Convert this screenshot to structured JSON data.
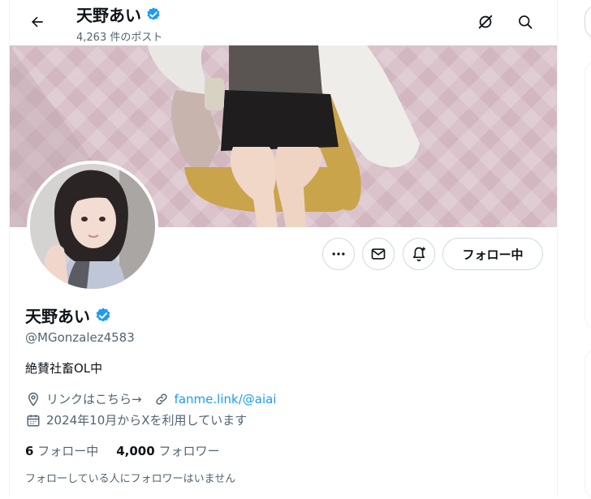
{
  "header": {
    "name": "天野あい",
    "post_count": "4,263 件のポスト",
    "verified": true,
    "back_icon": "arrow-left-icon",
    "right_icons": [
      "grok-icon",
      "search-icon"
    ]
  },
  "profile": {
    "name": "天野あい",
    "handle": "@MGonzalez4583",
    "bio": "絶賛社畜OL中",
    "link_label": "リンクはこちら→",
    "link_url": "fanme.link/@aiai",
    "joined": "2024年10月からXを利用しています",
    "following_count": "6",
    "following_label": "フォロー中",
    "followers_count": "4,000",
    "followers_label": "フォロワー",
    "mutual_note": "フォローしている人にフォロワーはいません"
  },
  "actions": {
    "follow_label": "フォロー中",
    "icons": [
      "more-icon",
      "message-icon",
      "notification-bell-icon"
    ]
  },
  "colors": {
    "accent": "#1d9bf0",
    "verified": "#1d9bf0",
    "secondary_text": "#536471",
    "banner_bg": "#c7a9b4"
  }
}
